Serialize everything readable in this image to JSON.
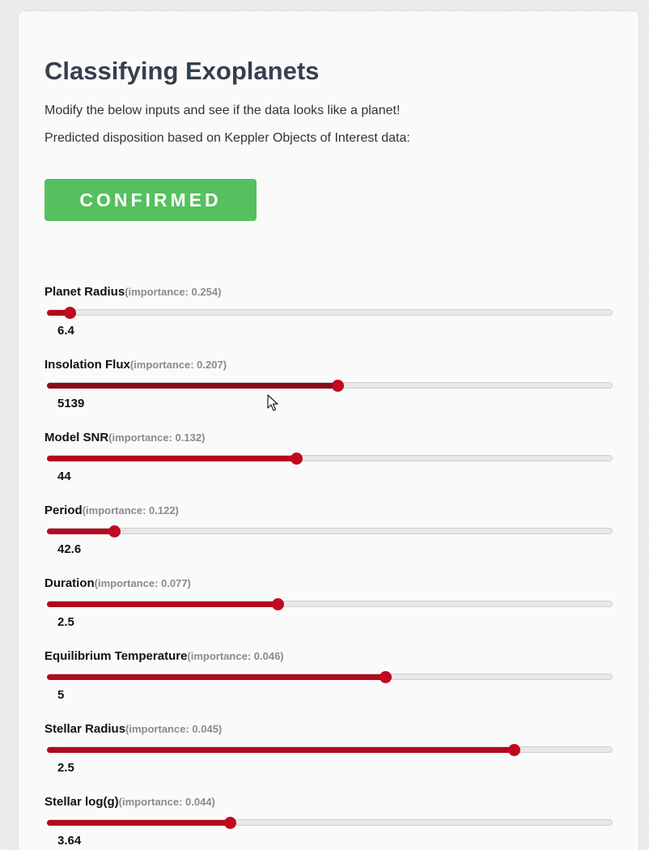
{
  "page": {
    "title": "Classifying Exoplanets",
    "intro": "Modify the below inputs and see if the data looks like a planet!",
    "subintro": "Predicted disposition based on Keppler Objects of Interest data:",
    "prediction": "CONFIRMED",
    "prediction_color": "#56c05f",
    "slider_color": "#b3081f"
  },
  "sliders": [
    {
      "label": "Planet Radius",
      "importance": "(importance: 0.254)",
      "value": "6.4",
      "fraction": 0.04
    },
    {
      "label": "Insolation Flux",
      "importance": "(importance: 0.207)",
      "value": "5139",
      "fraction": 0.513
    },
    {
      "label": "Model SNR",
      "importance": "(importance: 0.132)",
      "value": "44",
      "fraction": 0.44
    },
    {
      "label": "Period",
      "importance": "(importance: 0.122)",
      "value": "42.6",
      "fraction": 0.119
    },
    {
      "label": "Duration",
      "importance": "(importance: 0.077)",
      "value": "2.5",
      "fraction": 0.408
    },
    {
      "label": "Equilibrium Temperature",
      "importance": "(importance: 0.046)",
      "value": "5",
      "fraction": 0.598
    },
    {
      "label": "Stellar Radius",
      "importance": "(importance: 0.045)",
      "value": "2.5",
      "fraction": 0.826
    },
    {
      "label": "Stellar log(g)",
      "importance": "(importance: 0.044)",
      "value": "3.64",
      "fraction": 0.323
    }
  ]
}
